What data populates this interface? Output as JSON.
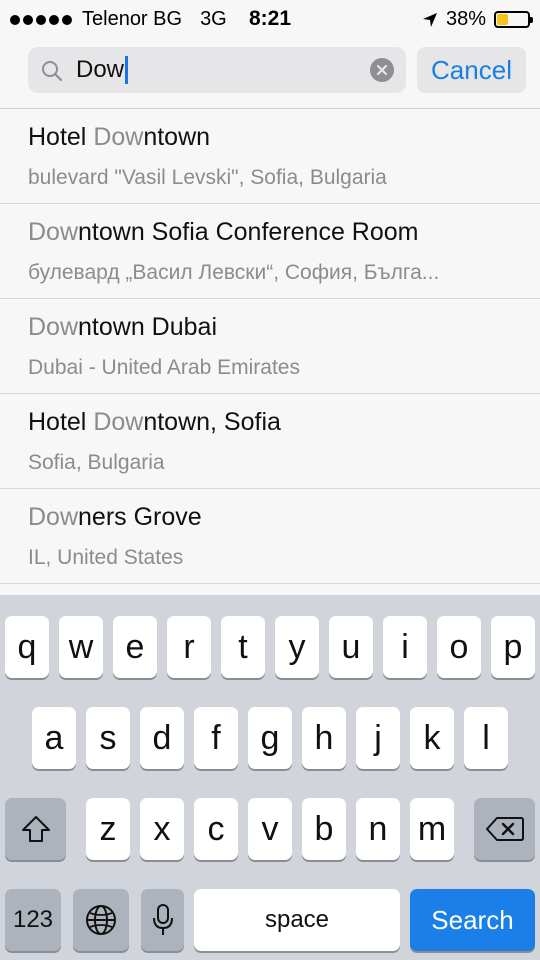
{
  "status_bar": {
    "carrier": "Telenor BG",
    "network": "3G",
    "time": "8:21",
    "battery": "38%",
    "battery_level": 0.38,
    "colors": {
      "battery": "#f5c518"
    }
  },
  "search": {
    "value": "Dow",
    "cancel_label": "Cancel",
    "accent_color": "#1a7fe0"
  },
  "results": [
    {
      "title_pre": "Hotel ",
      "title_match": "Dow",
      "title_post": "ntown",
      "subtitle": "bulevard \"Vasil Levski\", Sofia, Bulgaria"
    },
    {
      "title_pre": "",
      "title_match": "Dow",
      "title_post": "ntown Sofia Conference Room",
      "subtitle": "булевард „Васил Левски“, София, Бълга..."
    },
    {
      "title_pre": "",
      "title_match": "Dow",
      "title_post": "ntown Dubai",
      "subtitle": "Dubai - United Arab Emirates"
    },
    {
      "title_pre": "Hotel ",
      "title_match": "Dow",
      "title_post": "ntown, Sofia",
      "subtitle": "Sofia, Bulgaria"
    },
    {
      "title_pre": "",
      "title_match": "Dow",
      "title_post": "ners Grove",
      "subtitle": "IL, United States"
    }
  ],
  "keyboard": {
    "row1": [
      "q",
      "w",
      "e",
      "r",
      "t",
      "y",
      "u",
      "i",
      "o",
      "p"
    ],
    "row2": [
      "a",
      "s",
      "d",
      "f",
      "g",
      "h",
      "j",
      "k",
      "l"
    ],
    "row3": [
      "z",
      "x",
      "c",
      "v",
      "b",
      "n",
      "m"
    ],
    "numbers_label": "123",
    "space_label": "space",
    "search_label": "Search",
    "icons": {
      "shift": "shift-icon",
      "delete": "delete-icon",
      "globe": "globe-icon",
      "mic": "microphone-icon"
    }
  }
}
